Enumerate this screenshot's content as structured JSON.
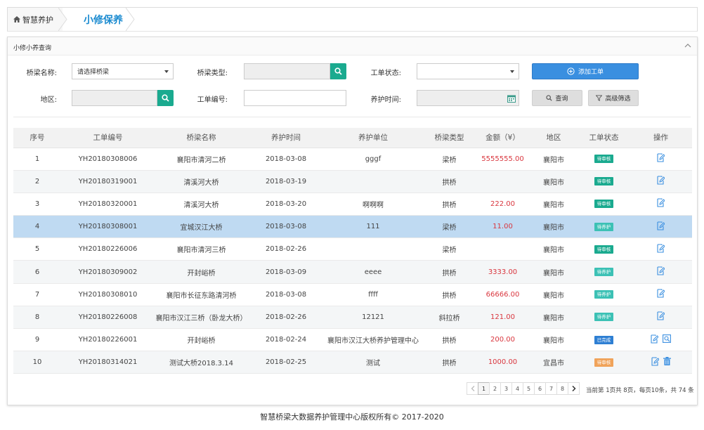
{
  "breadcrumb": {
    "home": "智慧养护",
    "current": "小修保养"
  },
  "panel": {
    "title": "小修小养查询"
  },
  "filters": {
    "bridge_name_label": "桥梁名称:",
    "bridge_name_value": "请选择桥梁",
    "bridge_type_label": "桥梁类型:",
    "order_status_label": "工单状态:",
    "region_label": "地区:",
    "order_no_label": "工单编号:",
    "maint_time_label": "养护时间:",
    "add_button": "添加工单",
    "query_button": "查询",
    "advanced_button": "高级筛选"
  },
  "table": {
    "headers": [
      "序号",
      "工单编号",
      "桥梁名称",
      "养护时间",
      "养护单位",
      "桥梁类型",
      "金额（¥）",
      "地区",
      "工单状态",
      "操作"
    ],
    "rows": [
      {
        "no": "1",
        "order": "YH20180308006",
        "bridge": "襄阳市清河二桥",
        "date": "2018-03-08",
        "unit": "gggf",
        "type": "梁桥",
        "amount": "5555555.00",
        "region": "襄阳市",
        "status": "待审核"
      },
      {
        "no": "2",
        "order": "YH20180319001",
        "bridge": "清溪河大桥",
        "date": "2018-03-19",
        "unit": "",
        "type": "拱桥",
        "amount": "",
        "region": "襄阳市",
        "status": "待审核"
      },
      {
        "no": "3",
        "order": "YH20180320001",
        "bridge": "清溪河大桥",
        "date": "2018-03-20",
        "unit": "啊啊啊",
        "type": "拱桥",
        "amount": "222.00",
        "region": "襄阳市",
        "status": "待审核"
      },
      {
        "no": "4",
        "order": "YH20180308001",
        "bridge": "宜城汉江大桥",
        "date": "2018-03-08",
        "unit": "111",
        "type": "梁桥",
        "amount": "11.00",
        "region": "襄阳市",
        "status": "待养护"
      },
      {
        "no": "5",
        "order": "YH20180226006",
        "bridge": "襄阳市清河三桥",
        "date": "2018-02-26",
        "unit": "",
        "type": "梁桥",
        "amount": "",
        "region": "襄阳市",
        "status": "待审核"
      },
      {
        "no": "6",
        "order": "YH20180309002",
        "bridge": "开封峪桥",
        "date": "2018-03-09",
        "unit": "eeee",
        "type": "拱桥",
        "amount": "3333.00",
        "region": "襄阳市",
        "status": "待养护"
      },
      {
        "no": "7",
        "order": "YH20180308010",
        "bridge": "襄阳市长征东路清河桥",
        "date": "2018-03-08",
        "unit": "ffff",
        "type": "拱桥",
        "amount": "66666.00",
        "region": "襄阳市",
        "status": "待养护"
      },
      {
        "no": "8",
        "order": "YH20180226008",
        "bridge": "襄阳市汉江三桥（卧龙大桥）",
        "date": "2018-02-26",
        "unit": "12121",
        "type": "斜拉桥",
        "amount": "121.00",
        "region": "襄阳市",
        "status": "待养护"
      },
      {
        "no": "9",
        "order": "YH20180226001",
        "bridge": "开封峪桥",
        "date": "2018-02-24",
        "unit": "襄阳市汉江大桥养护管理中心",
        "type": "拱桥",
        "amount": "200.00",
        "region": "襄阳市",
        "status": "已完成"
      },
      {
        "no": "10",
        "order": "YH20180314021",
        "bridge": "测试大桥2018.3.14",
        "date": "2018-02-25",
        "unit": "测试",
        "type": "拱桥",
        "amount": "1000.00",
        "region": "宜昌市",
        "status": "待审核"
      }
    ]
  },
  "status_colors": {
    "待审核": "#1aaa8f",
    "待养护": "#3cc1b5",
    "已完成": "#2e7fd3",
    "待审核-orange": "#f0a35a"
  },
  "pagination": {
    "pages": [
      "1",
      "2",
      "3",
      "4",
      "5",
      "6",
      "7",
      "8"
    ],
    "current": "1",
    "info": "当前第 1页共 8页，每页10条，共 74 条"
  },
  "footer": {
    "text": "智慧桥梁大数据养护管理中心版权所有© 2017-2020"
  }
}
